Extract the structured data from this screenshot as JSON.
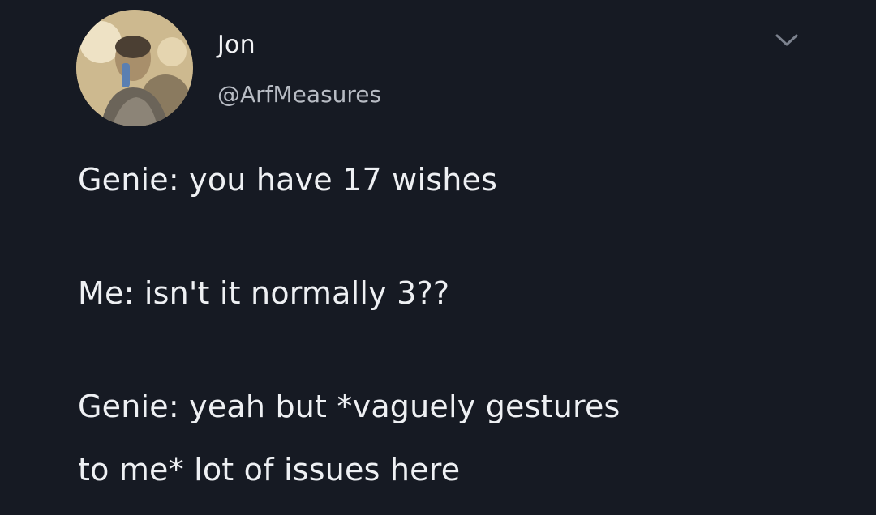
{
  "author": {
    "name": "Jon",
    "handle": "@ArfMeasures",
    "avatar_icon": "profile-photo"
  },
  "menu_icon": "chevron-down-icon",
  "tweet": {
    "line1": "Genie: you have 17 wishes",
    "line2": "Me: isn't it normally 3??",
    "line3": "Genie: yeah but *vaguely gestures",
    "line4": "to me* lot of issues here"
  },
  "colors": {
    "background": "#161a23",
    "text": "#eef0f3",
    "handle": "#b8bcc4"
  }
}
